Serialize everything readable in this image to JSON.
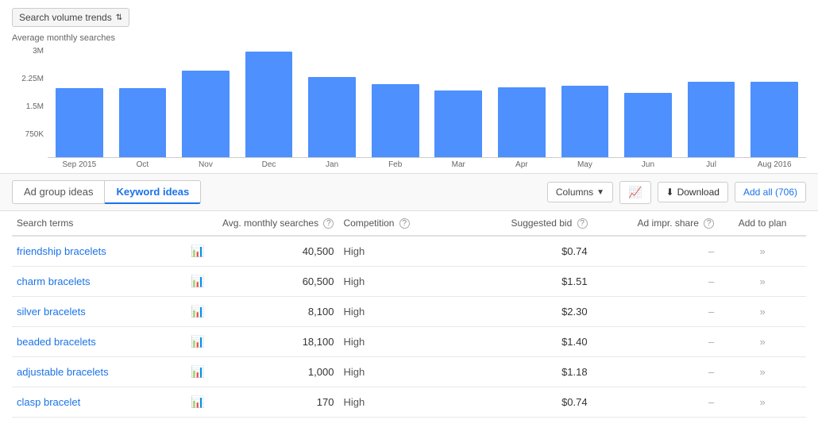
{
  "chart": {
    "title": "Search volume trends",
    "y_axis_label": "Average monthly searches",
    "y_ticks": [
      "3M",
      "2.25M",
      "1.5M",
      "750K",
      ""
    ],
    "bars": [
      {
        "label": "Sep 2015",
        "height_pct": 62
      },
      {
        "label": "Oct",
        "height_pct": 62
      },
      {
        "label": "Nov",
        "height_pct": 78
      },
      {
        "label": "Dec",
        "height_pct": 95
      },
      {
        "label": "Jan",
        "height_pct": 72
      },
      {
        "label": "Feb",
        "height_pct": 66
      },
      {
        "label": "Mar",
        "height_pct": 60
      },
      {
        "label": "Apr",
        "height_pct": 63
      },
      {
        "label": "May",
        "height_pct": 64
      },
      {
        "label": "Jun",
        "height_pct": 58
      },
      {
        "label": "Jul",
        "height_pct": 68
      },
      {
        "label": "Aug 2016",
        "height_pct": 68
      }
    ]
  },
  "toolbar": {
    "tabs": [
      {
        "id": "ad-group",
        "label": "Ad group ideas"
      },
      {
        "id": "keyword",
        "label": "Keyword ideas"
      }
    ],
    "active_tab": "keyword",
    "columns_label": "Columns",
    "download_label": "Download",
    "add_all_label": "Add all (706)"
  },
  "table": {
    "headers": [
      {
        "id": "search-terms",
        "label": "Search terms",
        "has_help": false
      },
      {
        "id": "trend",
        "label": "",
        "has_help": false
      },
      {
        "id": "avg-monthly",
        "label": "Avg. monthly searches",
        "has_help": true
      },
      {
        "id": "competition",
        "label": "Competition",
        "has_help": true
      },
      {
        "id": "suggested-bid",
        "label": "Suggested bid",
        "has_help": true
      },
      {
        "id": "ad-impr",
        "label": "Ad impr. share",
        "has_help": true
      },
      {
        "id": "add-to-plan",
        "label": "Add to plan",
        "has_help": false
      }
    ],
    "rows": [
      {
        "term": "friendship bracelets",
        "avg": "40,500",
        "competition": "High",
        "bid": "$0.74",
        "ad_impr": "–",
        "arrow": "»"
      },
      {
        "term": "charm bracelets",
        "avg": "60,500",
        "competition": "High",
        "bid": "$1.51",
        "ad_impr": "–",
        "arrow": "»"
      },
      {
        "term": "silver bracelets",
        "avg": "8,100",
        "competition": "High",
        "bid": "$2.30",
        "ad_impr": "–",
        "arrow": "»"
      },
      {
        "term": "beaded bracelets",
        "avg": "18,100",
        "competition": "High",
        "bid": "$1.40",
        "ad_impr": "–",
        "arrow": "»"
      },
      {
        "term": "adjustable bracelets",
        "avg": "1,000",
        "competition": "High",
        "bid": "$1.18",
        "ad_impr": "–",
        "arrow": "»"
      },
      {
        "term": "clasp bracelet",
        "avg": "170",
        "competition": "High",
        "bid": "$0.74",
        "ad_impr": "–",
        "arrow": "»"
      }
    ]
  }
}
